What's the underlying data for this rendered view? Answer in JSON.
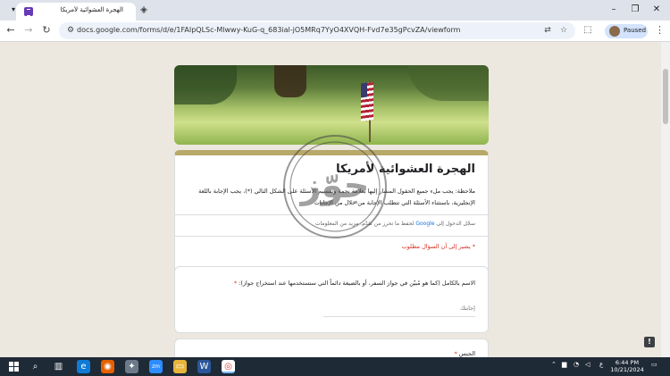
{
  "browser": {
    "tab": {
      "title": "الهجرة العشوائية لأمريكا",
      "close": "×"
    },
    "new_tab": "+",
    "window_controls": {
      "minimize": "–",
      "maximize": "❐",
      "close": "✕"
    },
    "nav": {
      "back": "←",
      "forward": "→",
      "reload": "↻"
    },
    "url": "docs.google.com/forms/d/e/1FAIpQLSc-Mlwwy-KuG-q_683ial-jO5MRq7YyO4XVQH-Fvd7e35gPcvZA/viewform",
    "profile_label": "Paused",
    "menu": "⋮"
  },
  "form": {
    "title": "الهجرة العشوائية لأمريكا",
    "description": "ملاحظة: يجب ملء جميع الحقول المشار إليها بعلامة نجمة وتقسيم الأسئلة على الشكل التالي (*)، يجب الإجابة باللغة الإنجليزية، باستثناء الأسئلة التي تتطلب الإجابة من خلال من الإجابات",
    "signin_text": "سجّل الدخول إلى",
    "signin_link": "Google",
    "signin_rest": "لحفظ ما تحرز من تقدّم. مزيد من المعلومات",
    "required_note": "* يشير إلى أن السؤال مطلوب",
    "questions": [
      {
        "label": "الاسم بالكامل (كما هو مُبيّن في جواز السفر، أو بالصيغة دائماً التي ستستخدمها عند استخراج جواز):",
        "required": "*",
        "placeholder": "إجابتك"
      },
      {
        "label": "الجنس",
        "required": "*"
      }
    ]
  },
  "watermark": "جوّز",
  "report_button": "!",
  "taskbar": {
    "clock_time": "6:44 PM",
    "clock_date": "10/21/2024",
    "lang": "ع"
  },
  "colors": {
    "accent": "#b8a96a",
    "page_bg": "#ece8df",
    "required_red": "#d93025",
    "link_blue": "#1a73e8"
  }
}
